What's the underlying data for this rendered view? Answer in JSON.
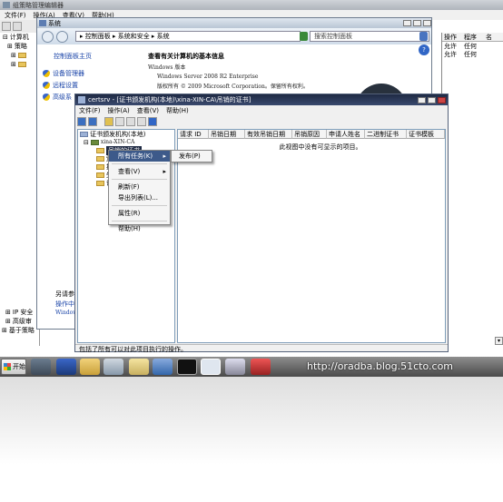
{
  "gp": {
    "title": "组策略管理编辑器",
    "menu": [
      "文件(F)",
      "操作(A)",
      "查看(V)",
      "帮助(H)"
    ],
    "tree": [
      "计算机",
      "策略"
    ],
    "tree_bottom": [
      "IP 安全",
      "高级审",
      "基于策略"
    ],
    "right_cols": [
      "操作",
      "程序",
      "名"
    ],
    "right_rows": [
      [
        "允许",
        "任何"
      ],
      [
        "允许",
        "任何"
      ]
    ]
  },
  "cp": {
    "title": "系统",
    "path": "▸ 控制面板 ▸ 系统和安全 ▸ 系统",
    "search_placeholder": "搜索控制面板",
    "left_home": "控制面板主页",
    "left_links": [
      "设备管理器",
      "远程设置",
      "高级系"
    ],
    "see_also": "另请参",
    "action_center": "操作中",
    "win_update": "Windows",
    "heading": "查看有关计算机的基本信息",
    "edition_label": "Windows 版本",
    "edition": "Windows Server 2008 R2 Enterprise",
    "copyright": "版权所有 © 2009 Microsoft Corporation。保留所有权利。"
  },
  "cs": {
    "title": "certsrv - [证书颁发机构(本地)\\xina-XIN-CA\\吊销的证书]",
    "menu": [
      "文件(F)",
      "操作(A)",
      "查看(V)",
      "帮助(H)"
    ],
    "tree_root": "证书颁发机构(本地)",
    "tree_ca": "xina-XIN-CA",
    "tree_items": [
      "吊销的证书",
      "颁",
      "挂",
      "失",
      "证"
    ],
    "columns": [
      "请求 ID",
      "吊销日期",
      "有效吊销日期",
      "吊销原因",
      "申请人姓名",
      "二进制证书",
      "证书模板"
    ],
    "empty_msg": "此视图中没有可显示的项目。",
    "status": "包括了所有可以对此项目执行的操作。"
  },
  "context_menu": {
    "items": [
      "所有任务(K)",
      "查看(V)",
      "刷新(F)",
      "导出列表(L)...",
      "属性(R)",
      "帮助(H)"
    ],
    "submenu": "发布(P)"
  },
  "taskbar": {
    "start": "开始",
    "watermark": "http://oradba.blog.51cto.com"
  },
  "colors": {
    "accent": "#3d5a8a",
    "link": "#1a44a8",
    "cs_title": "#1f2a44"
  }
}
